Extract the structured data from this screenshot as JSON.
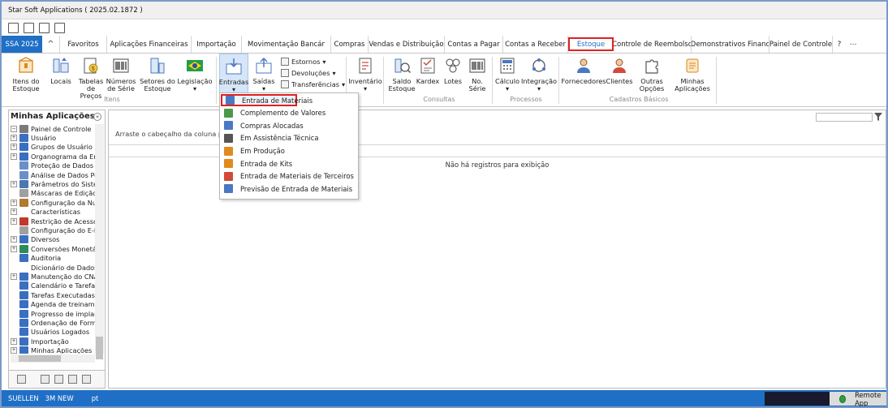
{
  "window": {
    "title": "Star Soft Applications ( 2025.02.1872 )"
  },
  "tabs": {
    "app": "SSA 2025",
    "collapse_glyph": "^",
    "items": [
      "Favoritos",
      "Aplicações Financeiras",
      "Importação",
      "Movimentação Bancár",
      "Compras",
      "Vendas e Distribuição",
      "Contas a Pagar",
      "Contas a Receber",
      "Estoque",
      "Controle de Reembolso",
      "Demonstrativos Financ",
      "Painel de Controle"
    ],
    "active": "Estoque",
    "help": "?",
    "more": "⋯"
  },
  "ribbon": {
    "itens": {
      "itens_estoque": [
        "Itens do",
        "Estoque"
      ],
      "locais": "Locais",
      "tabelas_precos": [
        "Tabelas",
        "de Preços"
      ],
      "numeros_serie": [
        "Números",
        "de Série"
      ],
      "setores_estoque": [
        "Setores do",
        "Estoque"
      ],
      "legislacao": "Legislação",
      "group": "Itens"
    },
    "movimentos": {
      "entradas": "Entradas",
      "saidas": "Saídas",
      "estornos": "Estornos",
      "devolucoes": "Devoluções",
      "transferencias": "Transferências"
    },
    "inventario": "Inventário",
    "consultas": {
      "saldo_estoque": [
        "Saldo",
        "Estoque"
      ],
      "kardex": "Kardex",
      "lotes": "Lotes",
      "no_serie": [
        "No.",
        "Série"
      ],
      "group": "Consultas"
    },
    "processos": {
      "calculo": "Cálculo",
      "integracao": "Integração",
      "group": "Processos"
    },
    "cadastros": {
      "fornecedores": "Fornecedores",
      "clientes": "Clientes",
      "outras_opcoes": [
        "Outras",
        "Opções"
      ],
      "minhas_aplicacoes": [
        "Minhas",
        "Aplicações"
      ],
      "group": "Cadastros Básicos"
    }
  },
  "dropdown": {
    "items": [
      {
        "label": "Entrada de Materiais",
        "icon": "entrada-materiais-icon",
        "color": "#4a78c2"
      },
      {
        "label": "Complemento de Valores",
        "icon": "complemento-valores-icon",
        "color": "#4a9a4a"
      },
      {
        "label": "Compras Alocadas",
        "icon": "compras-alocadas-icon",
        "color": "#4a78c2"
      },
      {
        "label": "Em Assistência Técnica",
        "icon": "tools-icon",
        "color": "#555555"
      },
      {
        "label": "Em Produção",
        "icon": "producao-icon",
        "color": "#e08a1e"
      },
      {
        "label": "Entrada de Kits",
        "icon": "kits-icon",
        "color": "#e08a1e"
      },
      {
        "label": "Entrada de Materiais de Terceiros",
        "icon": "terceiros-icon",
        "color": "#d24a3a"
      },
      {
        "label": "Previsão de Entrada de Materiais",
        "icon": "previsao-icon",
        "color": "#4a78c2"
      }
    ],
    "highlighted": "Entrada de Materiais"
  },
  "sidebar": {
    "title": "Minhas Aplicações",
    "collapse_glyph": "«",
    "tree": [
      {
        "label": "Painel de Controle",
        "exp": "−",
        "icon": "#7a7a7a"
      },
      {
        "label": "Usuário",
        "exp": "+",
        "icon": "#3a6fc0"
      },
      {
        "label": "Grupos de Usuário",
        "exp": "+",
        "icon": "#3a6fc0"
      },
      {
        "label": "Organograma da Em",
        "exp": "+",
        "icon": "#3a6fc0"
      },
      {
        "label": "Proteção de Dados P",
        "exp": "",
        "icon": "#6a8fc9"
      },
      {
        "label": "Análise de Dados Pe",
        "exp": "",
        "icon": "#6a8fc9"
      },
      {
        "label": "Parâmetros do Sister",
        "exp": "+",
        "icon": "#4a78b0"
      },
      {
        "label": "Máscaras de Edição",
        "exp": "",
        "icon": "#a0a0a0"
      },
      {
        "label": "Configuração da Nu",
        "exp": "+",
        "icon": "#b07a30"
      },
      {
        "label": "Características",
        "exp": "+",
        "icon": ""
      },
      {
        "label": "Restrição de Acesso",
        "exp": "+",
        "icon": "#c0392b"
      },
      {
        "label": "Configuração do E-M",
        "exp": "",
        "icon": "#a0a0a0"
      },
      {
        "label": "Diversos",
        "exp": "+",
        "icon": "#3a6fc0"
      },
      {
        "label": "Conversões Monetá",
        "exp": "+",
        "icon": "#2e8b57"
      },
      {
        "label": "Auditoria",
        "exp": "",
        "icon": "#3a6fc0"
      },
      {
        "label": "Dicionário de Dados",
        "exp": "",
        "icon": ""
      },
      {
        "label": "Manutenção do CNA",
        "exp": "+",
        "icon": "#3a6fc0"
      },
      {
        "label": "Calendário e Tarefas",
        "exp": "",
        "icon": "#3a6fc0"
      },
      {
        "label": "Tarefas Executadas",
        "exp": "",
        "icon": "#3a6fc0"
      },
      {
        "label": "Agenda de treiname",
        "exp": "",
        "icon": "#3a6fc0"
      },
      {
        "label": "Progresso de implar",
        "exp": "",
        "icon": "#3a6fc0"
      },
      {
        "label": "Ordenação de Form",
        "exp": "",
        "icon": "#3a6fc0"
      },
      {
        "label": "Usuários Logados",
        "exp": "",
        "icon": "#3a6fc0"
      },
      {
        "label": "Importação",
        "exp": "+",
        "icon": "#3a6fc0"
      },
      {
        "label": "Minhas Aplicações",
        "exp": "+",
        "icon": "#3a6fc0"
      }
    ]
  },
  "main": {
    "group_hint": "Arraste o cabeçalho da coluna par",
    "no_records": "Não há registros para exibição"
  },
  "status": {
    "user": "SUELLEN",
    "env": "3M NEW",
    "lang": "pt",
    "remote": "Remote App"
  },
  "colors": {
    "accent": "#1f6fc6",
    "highlight_border": "#e02020"
  }
}
